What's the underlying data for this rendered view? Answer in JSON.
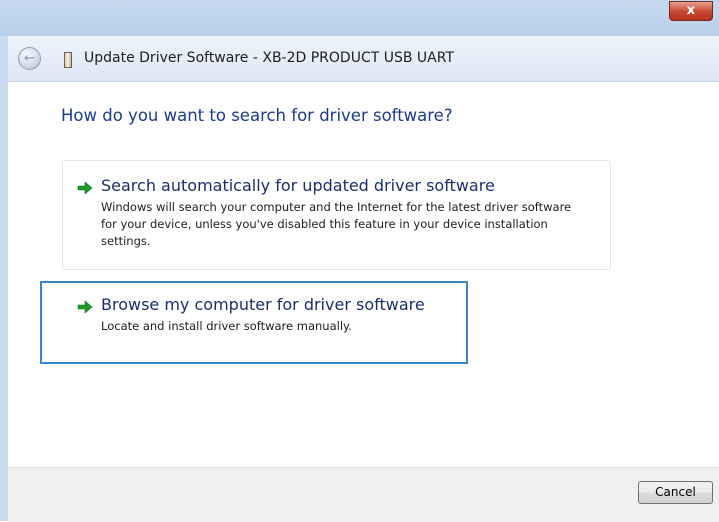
{
  "window": {
    "close_label": "x"
  },
  "header": {
    "back_icon": "back-arrow-icon",
    "title": "Update Driver Software - XB-2D PRODUCT USB UART"
  },
  "main": {
    "question": "How do you want to search for driver software?",
    "options": [
      {
        "title": "Search automatically for updated driver software",
        "description_lines": [
          "Windows will search your computer and the Internet for the latest driver software",
          "for your device, unless you've disabled this feature in your device installation",
          "settings."
        ]
      },
      {
        "title": "Browse my computer for driver software",
        "description_lines": [
          "Locate and install driver software manually."
        ]
      }
    ]
  },
  "footer": {
    "cancel_label": "Cancel"
  },
  "colors": {
    "accent_blue": "#1b3c8c",
    "selection_border": "#3a86c8",
    "arrow_green": "#1e9a2a"
  }
}
